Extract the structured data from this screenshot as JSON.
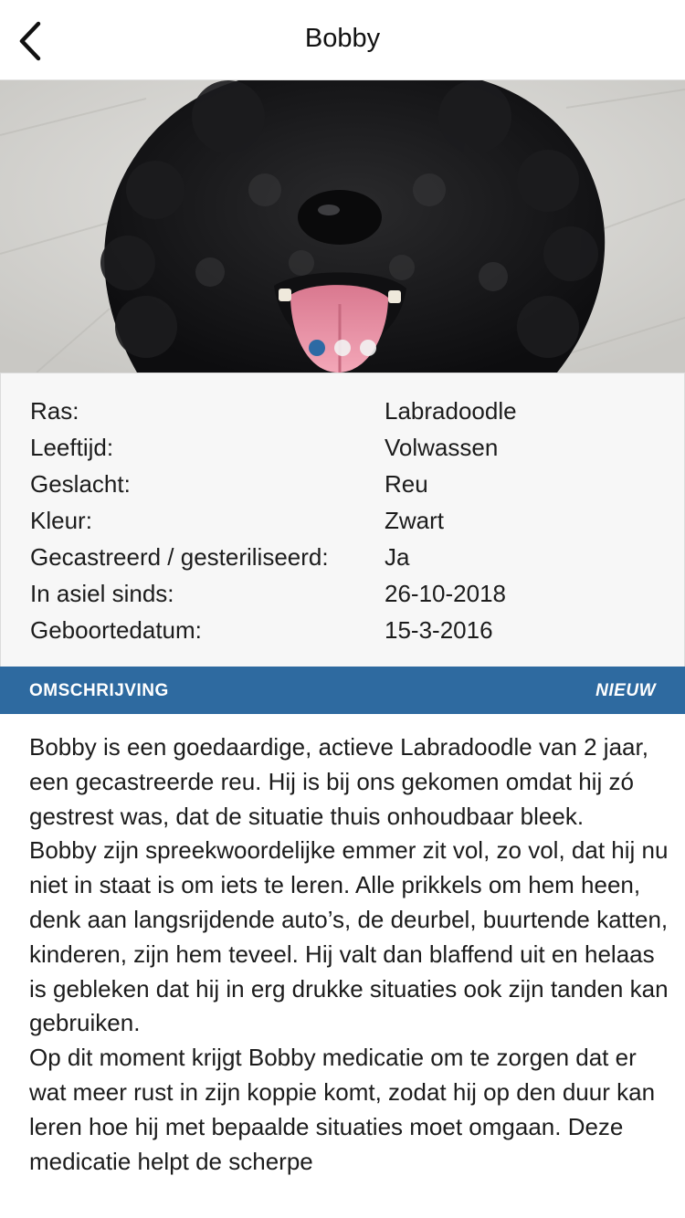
{
  "nav": {
    "title": "Bobby",
    "back_icon": "chevron-left-icon"
  },
  "gallery": {
    "image_subject": "black dog photo",
    "dots": [
      "active",
      "inactive",
      "inactive"
    ],
    "accent_color": "#2d6aa4"
  },
  "details": [
    {
      "label": "Ras:",
      "value": "Labradoodle"
    },
    {
      "label": "Leeftijd:",
      "value": "Volwassen"
    },
    {
      "label": "Geslacht:",
      "value": "Reu"
    },
    {
      "label": "Kleur:",
      "value": "Zwart"
    },
    {
      "label": "Gecastreerd / gesteriliseerd:",
      "value": "Ja"
    },
    {
      "label": "In asiel sinds:",
      "value": "26-10-2018"
    },
    {
      "label": "Geboortedatum:",
      "value": "15-3-2016"
    }
  ],
  "section": {
    "title": "OMSCHRIJVING",
    "tag": "NIEUW",
    "bar_color": "#2e6aa0"
  },
  "description": [
    "Bobby is een goedaardige, actieve Labradoodle van 2 jaar, een gecastreerde reu. Hij is bij ons gekomen omdat hij zó gestrest was, dat de situatie thuis onhoudbaar bleek.",
    "Bobby zijn spreekwoordelijke emmer zit vol, zo vol, dat hij nu niet in staat is om iets te leren. Alle prikkels om hem heen, denk aan langsrijdende auto’s, de deurbel, buurtende katten, kinderen, zijn hem teveel. Hij valt dan blaffend uit en helaas is gebleken dat hij in erg drukke situaties ook zijn tanden kan gebruiken.",
    "Op dit moment krijgt Bobby medicatie om te zorgen dat er wat meer rust in zijn koppie komt, zodat hij op den duur kan leren hoe hij met bepaalde situaties moet omgaan. Deze medicatie helpt de scherpe"
  ]
}
